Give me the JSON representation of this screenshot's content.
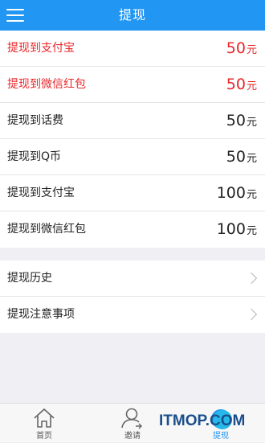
{
  "header": {
    "title": "提现",
    "menu_icon": "hamburger-menu-icon",
    "color": "#2196f3"
  },
  "options": [
    {
      "label": "提现到支付宝",
      "amount": "50",
      "unit": "元",
      "highlight": true
    },
    {
      "label": "提现到微信红包",
      "amount": "50",
      "unit": "元",
      "highlight": true
    },
    {
      "label": "提现到话费",
      "amount": "50",
      "unit": "元",
      "highlight": false
    },
    {
      "label": "提现到Q币",
      "amount": "50",
      "unit": "元",
      "highlight": false
    },
    {
      "label": "提现到支付宝",
      "amount": "100",
      "unit": "元",
      "highlight": false
    },
    {
      "label": "提现到微信红包",
      "amount": "100",
      "unit": "元",
      "highlight": false
    }
  ],
  "more": [
    {
      "label": "提现历史",
      "icon": "chevron-right-icon"
    },
    {
      "label": "提现注意事项",
      "icon": "chevron-right-icon"
    }
  ],
  "tabbar": {
    "tabs": [
      {
        "label": "首页",
        "icon": "home-icon"
      },
      {
        "label": "邀请",
        "icon": "user-icon"
      },
      {
        "label": "提现",
        "icon": "yen-icon",
        "active": true
      }
    ]
  },
  "watermark": "ITMOP.COM",
  "colors": {
    "accent": "#2196f3",
    "highlight": "#e8262a",
    "background": "#efeff4"
  }
}
